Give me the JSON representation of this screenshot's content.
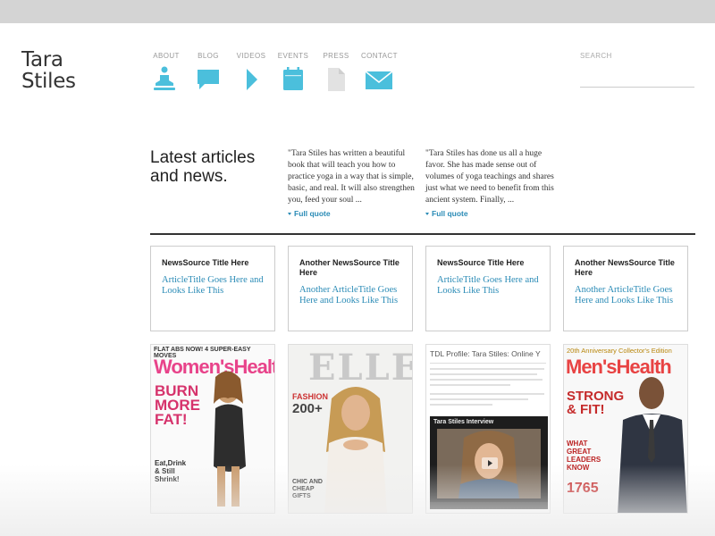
{
  "brand": {
    "line1": "Tara",
    "line2": "Stiles"
  },
  "colors": {
    "accent": "#4bbfdc",
    "link": "#2a8bb6"
  },
  "nav": [
    {
      "label": "ABOUT",
      "icon": "yoga-figure-icon"
    },
    {
      "label": "BLOG",
      "icon": "speech-bubble-icon"
    },
    {
      "label": "VIDEOS",
      "icon": "play-icon"
    },
    {
      "label": "EVENTS",
      "icon": "calendar-icon"
    },
    {
      "label": "PRESS",
      "icon": "document-icon"
    },
    {
      "label": "CONTACT",
      "icon": "envelope-icon"
    }
  ],
  "search": {
    "label": "SEARCH",
    "value": ""
  },
  "news": {
    "heading_line1": "Latest articles",
    "heading_line2": "and news.",
    "quotes": [
      {
        "text": "\"Tara Stiles has written a beautiful book that will teach you how to practice yoga in a way that is simple, basic, and real. It will also strengthen you, feed your soul ...",
        "link": "Full quote"
      },
      {
        "text": "\"Tara Stiles has done us all a huge favor. She has made sense out of volumes of yoga teachings and shares just what we need to benefit from this ancient system. Finally, ...",
        "link": "Full quote"
      }
    ]
  },
  "cards": [
    {
      "source": "NewsSource Title Here",
      "title": "ArticleTitle Goes Here and Looks Like This"
    },
    {
      "source": "Another NewsSource Title Here",
      "title": "Another ArticleTitle Goes Here and Looks Like This"
    },
    {
      "source": "NewsSource Title Here",
      "title": "ArticleTitle Goes Here and Looks Like This"
    },
    {
      "source": "Another NewsSource Title Here",
      "title": "Another ArticleTitle Goes Here and Looks Like This"
    }
  ],
  "thumbs": [
    {
      "kind": "magazine",
      "banner": "FLAT ABS NOW! 4 SUPER-EASY MOVES",
      "masthead": "Women'sHealth",
      "cover_lines": [
        "BURN",
        "MORE",
        "FAT!"
      ],
      "extra": "Eat,Drink & Still Shrink!"
    },
    {
      "kind": "magazine",
      "masthead": "ELLE",
      "cover_lines": [
        "FASHION",
        "200+"
      ],
      "extra": "CHIC AND CHEAP GIFTS"
    },
    {
      "kind": "webpage",
      "title": "TDL Profile: Tara Stiles: Online Y",
      "video_title": "Tara Stiles Interview"
    },
    {
      "kind": "magazine",
      "banner": "20th Anniversary Collector's Edition",
      "masthead": "Men'sHealth",
      "cover_lines": [
        "STRONG",
        "& FIT!"
      ],
      "extra": "WHAT GREAT LEADERS KNOW",
      "number": "1765"
    }
  ]
}
